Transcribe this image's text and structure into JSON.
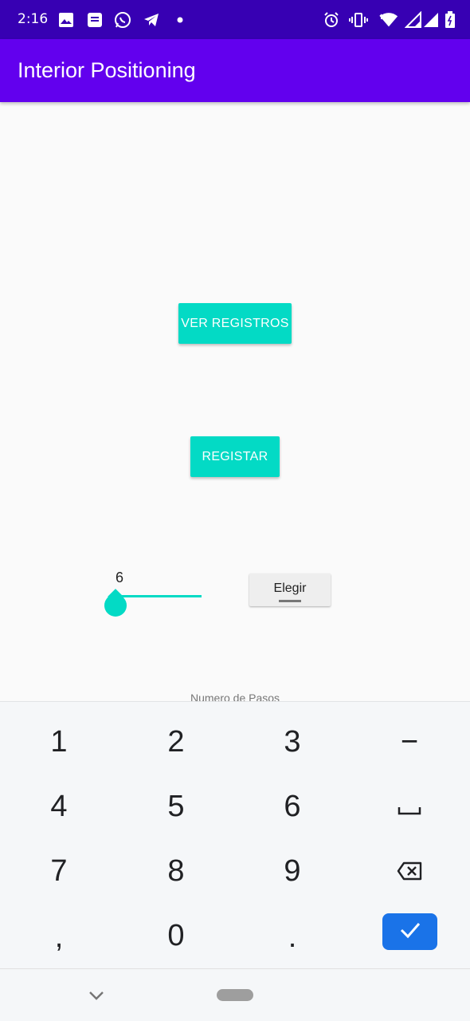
{
  "status_bar": {
    "time": "2:16",
    "left_icons": [
      "image-icon",
      "message-icon",
      "whatsapp-icon",
      "telegram-icon",
      "dot-icon"
    ],
    "right_icons": [
      "alarm-icon",
      "vibrate-icon",
      "wifi-icon",
      "signal-icon",
      "signal-icon",
      "battery-icon"
    ],
    "background": "#3700b3"
  },
  "app_bar": {
    "title": "Interior Positioning",
    "background": "#6200ee"
  },
  "main": {
    "ver_registros_label": "VER REGISTROS",
    "registar_label": "REGISTAR",
    "slider": {
      "value": "6",
      "fraction": 0.0
    },
    "spinner": {
      "selected": "Elegir"
    },
    "field_hint": "Numero de Pasos",
    "accent": "#03dac5"
  },
  "keyboard": {
    "rows": [
      [
        "1",
        "2",
        "3",
        "−"
      ],
      [
        "4",
        "5",
        "6",
        "space-icon"
      ],
      [
        "7",
        "8",
        "9",
        "backspace-icon"
      ],
      [
        ",",
        "0",
        ".",
        "check-icon"
      ]
    ],
    "done_color": "#1a73e8"
  },
  "nav_bar": {
    "icons": [
      "chevron-down-icon",
      "home-pill"
    ]
  }
}
